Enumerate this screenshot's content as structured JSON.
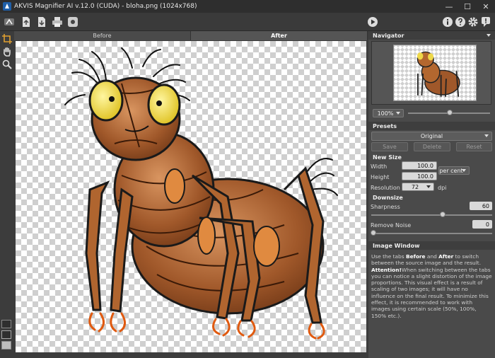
{
  "window": {
    "title": "AKVIS Magnifier AI v.12.0 (CUDA) - bloha.png (1024x768)",
    "minimize_glyph": "—",
    "maximize_glyph": "☐",
    "close_glyph": "✕"
  },
  "tabs": {
    "before": "Before",
    "after": "After",
    "active": "after"
  },
  "panel": {
    "navigator": {
      "title": "Navigator",
      "zoom": "100%"
    },
    "presets": {
      "title": "Presets",
      "selected": "Original",
      "save": "Save",
      "delete": "Delete",
      "reset": "Reset"
    },
    "new_size": {
      "title": "New Size",
      "width_label": "Width",
      "width_value": "100.0",
      "height_label": "Height",
      "height_value": "100.0",
      "units": "per cent",
      "resolution_label": "Resolution",
      "resolution_value": "72",
      "resolution_unit": "dpi"
    },
    "downsize": {
      "title": "Downsize",
      "sharpness_label": "Sharpness",
      "sharpness_value": "60",
      "noise_label": "Remove Noise",
      "noise_value": "0"
    },
    "help": {
      "title": "Image Window",
      "p1_a": "Use the tabs ",
      "p1_b": "Before",
      "p1_c": " and ",
      "p1_d": "After",
      "p1_e": " to switch between the source image and the result.",
      "attention": "Attention!",
      "p2": "When switching between the tabs you can notice a slight distortion of the image proportions. This visual effect is a result of scaling of two images; it will have no influence on the final result. To minimize this effect, it is recommended to work with images using certain scale (50%, 100%, 150% etc.)."
    }
  },
  "colors": {
    "panel_bg": "#4a4a4a",
    "accent": "#1f5fa8",
    "flea_body": "#a0582a"
  }
}
